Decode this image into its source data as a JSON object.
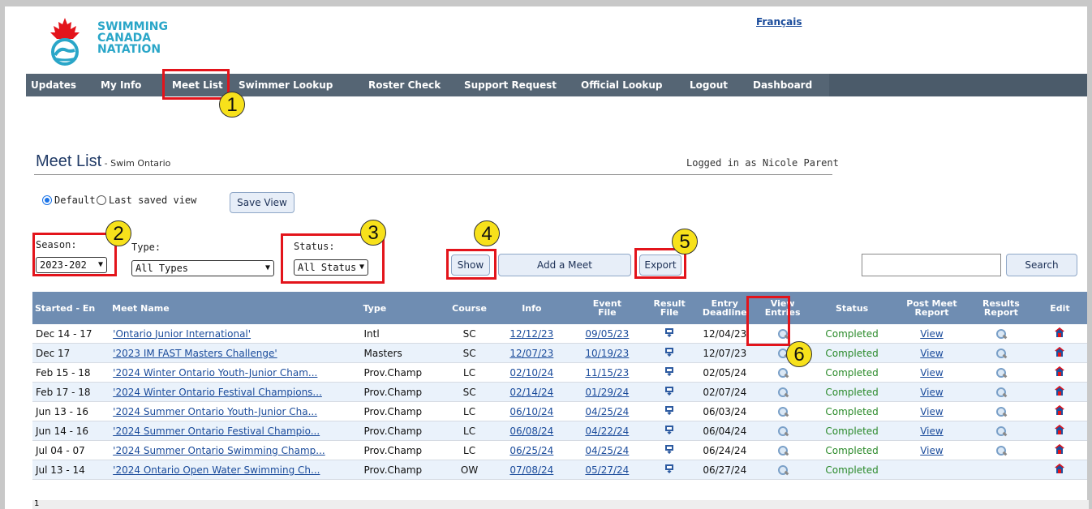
{
  "logo": {
    "line1": "SWIMMING",
    "line2": "CANADA",
    "line3": "NATATION"
  },
  "language_link": "Français",
  "nav": [
    {
      "label": "Updates"
    },
    {
      "label": "My Info"
    },
    {
      "label": "Meet List"
    },
    {
      "label": "Swimmer Lookup"
    },
    {
      "label": "Roster Check"
    },
    {
      "label": "Support Request"
    },
    {
      "label": "Official Lookup"
    },
    {
      "label": "Logout"
    },
    {
      "label": "Dashboard"
    }
  ],
  "page": {
    "title": "Meet List",
    "subtitle": " - Swim Ontario",
    "logged_in": "Logged in as Nicole Parent"
  },
  "view": {
    "default_label": "Default",
    "last_saved_label": "Last saved view",
    "save_button": "Save View"
  },
  "filters": {
    "season_label": "Season:",
    "season_value": "2023-202",
    "type_label": "Type:",
    "type_value": "All Types",
    "status_label": "Status:",
    "status_value": "All Status"
  },
  "actions": {
    "show": "Show",
    "add_meet": "Add a Meet",
    "export": "Export",
    "search": "Search",
    "search_value": ""
  },
  "callouts": [
    "1",
    "2",
    "3",
    "4",
    "5",
    "6"
  ],
  "table": {
    "headers": [
      "Started - En",
      "Meet Name",
      "Type",
      "Course",
      "Info",
      "Event File",
      "Result File",
      "Entry Deadline",
      "View Entries",
      "Status",
      "Post Meet Report",
      "Results Report",
      "Edit"
    ],
    "header_lines": {
      "event": [
        "Event",
        "File"
      ],
      "result": [
        "Result",
        "File"
      ],
      "entry": [
        "Entry",
        "Deadline"
      ],
      "view": [
        "View",
        "Entries"
      ],
      "post": [
        "Post Meet",
        "Report"
      ],
      "results": [
        "Results",
        "Report"
      ]
    },
    "rows": [
      {
        "dates": "Dec 14 - 17",
        "name": "'Ontario Junior International'",
        "type": "Intl",
        "course": "SC",
        "info": "12/12/23",
        "event": "09/05/23",
        "deadline": "12/04/23",
        "status": "Completed",
        "post": "View",
        "bold": false
      },
      {
        "dates": "Dec 17",
        "name": "'2023 IM FAST Masters Challenge'",
        "type": "Masters",
        "course": "SC",
        "info": "12/07/23",
        "event": "10/19/23",
        "deadline": "12/07/23",
        "status": "Completed",
        "post": "View",
        "bold": true
      },
      {
        "dates": "Feb 15 - 18",
        "name": "'2024 Winter Ontario Youth-Junior Cham...",
        "type": "Prov.Champ",
        "course": "LC",
        "info": "02/10/24",
        "event": "11/15/23",
        "deadline": "02/05/24",
        "status": "Completed",
        "post": "View",
        "bold": false
      },
      {
        "dates": "Feb 17 - 18",
        "name": "'2024 Winter Ontario Festival Champions...",
        "type": "Prov.Champ",
        "course": "SC",
        "info": "02/14/24",
        "event": "01/29/24",
        "deadline": "02/07/24",
        "status": "Completed",
        "post": "View",
        "bold": true
      },
      {
        "dates": "Jun 13 - 16",
        "name": "'2024 Summer Ontario Youth-Junior Cha...",
        "type": "Prov.Champ",
        "course": "LC",
        "info": "06/10/24",
        "event": "04/25/24",
        "deadline": "06/03/24",
        "status": "Completed",
        "post": "View",
        "bold": false
      },
      {
        "dates": "Jun 14 - 16",
        "name": "'2024 Summer Ontario Festival Champio...",
        "type": "Prov.Champ",
        "course": "LC",
        "info": "06/08/24",
        "event": "04/22/24",
        "deadline": "06/04/24",
        "status": "Completed",
        "post": "View",
        "bold": true
      },
      {
        "dates": "Jul 04 - 07",
        "name": "'2024 Summer Ontario Swimming Champ...",
        "type": "Prov.Champ",
        "course": "LC",
        "info": "06/25/24",
        "event": "04/25/24",
        "deadline": "06/24/24",
        "status": "Completed",
        "post": "View",
        "bold": false
      },
      {
        "dates": "Jul 13 - 14",
        "name": "'2024 Ontario Open Water Swimming Ch...",
        "type": "Prov.Champ",
        "course": "OW",
        "info": "07/08/24",
        "event": "05/27/24",
        "deadline": "06/27/24",
        "status": "Completed",
        "post": "",
        "bold": true
      }
    ],
    "footer": "1"
  },
  "colors": {
    "nav_bg": "#556574",
    "header_bg": "#6f8db2",
    "callout_box": "#e3141b",
    "callout_badge": "#f7e11b",
    "status_green": "#2a8a2a"
  },
  "icons": {
    "result_file": "download-file-icon",
    "view_entries": "magnifier-icon",
    "results_report": "magnifier-icon",
    "edit": "edit-house-icon"
  }
}
